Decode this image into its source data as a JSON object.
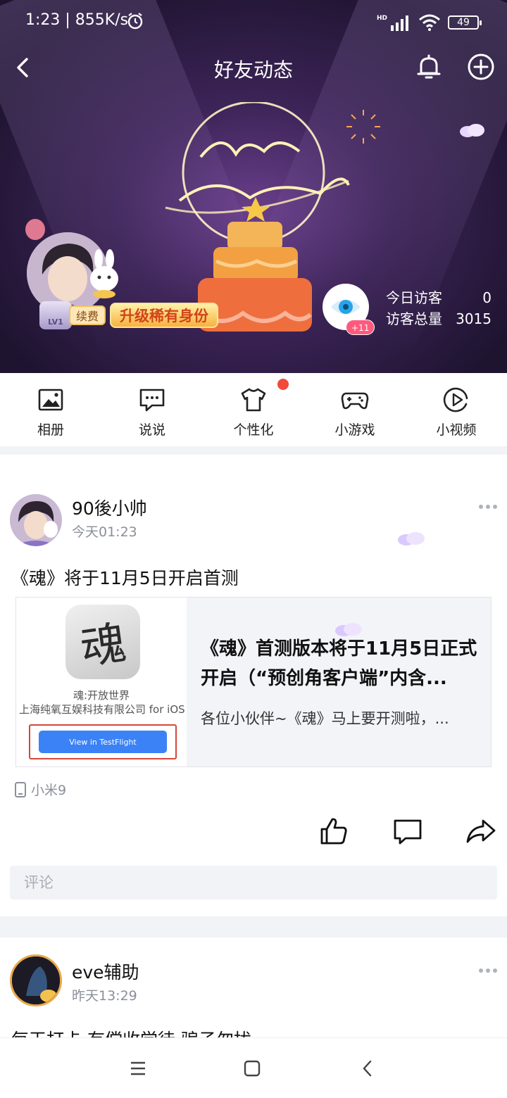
{
  "status_bar": {
    "time": "1:23 | 855K/s",
    "network_badge": "HD",
    "battery": "49",
    "icons": [
      "alarm-icon",
      "signal-icon",
      "wifi-icon",
      "battery-icon"
    ]
  },
  "header": {
    "title": "好友动态",
    "icons": [
      "back-arrow-icon",
      "bell-icon",
      "add-circle-icon"
    ]
  },
  "banner": {
    "theme": "Happy Birthday",
    "level": "LV1",
    "renew_label": "续费",
    "upgrade_label": "升级稀有身份",
    "eye_badge": "+11",
    "visitors_today_label": "今日访客",
    "visitors_today": "0",
    "visitors_total_label": "访客总量",
    "visitors_total": "3015"
  },
  "quick_nav": {
    "items": [
      {
        "label": "相册",
        "icon": "album-icon"
      },
      {
        "label": "说说",
        "icon": "chat-bubble-icon"
      },
      {
        "label": "个性化",
        "icon": "tshirt-icon",
        "has_dot": true
      },
      {
        "label": "小游戏",
        "icon": "gamepad-icon"
      },
      {
        "label": "小视频",
        "icon": "play-circle-icon"
      }
    ]
  },
  "posts": [
    {
      "author": "90後小帅",
      "time": "今天01:23",
      "text": "《魂》将于11月5日开启首测",
      "share": {
        "app_glyph": "魂",
        "app_name": "魂:开放世界",
        "app_company": "上海纯氧互娱科技有限公司 for iOS",
        "app_button": "View in TestFlight",
        "title": "《魂》首测版本将于11月5日正式开启（“预创角客户端”内含...",
        "description": "各位小伙伴~《魂》马上要开测啦，..."
      },
      "device": "小米9",
      "comment_placeholder": "评论",
      "actions": [
        "like-icon",
        "comment-icon",
        "share-icon"
      ]
    },
    {
      "author": "eve辅助",
      "time": "昨天13:29",
      "text": "每天打卡 有偿收学徒 骗子勿扰"
    }
  ],
  "colors": {
    "banner_dark": "#1e1430",
    "banner_purple": "#6a3f8c",
    "notification_dot": "#f24a3a",
    "upgrade_text": "#d2431b",
    "link_blue": "#3b82f6",
    "secondary_text": "#8b8f98"
  },
  "system_nav": [
    "menu-icon",
    "home-square-icon",
    "back-chevron-icon"
  ]
}
